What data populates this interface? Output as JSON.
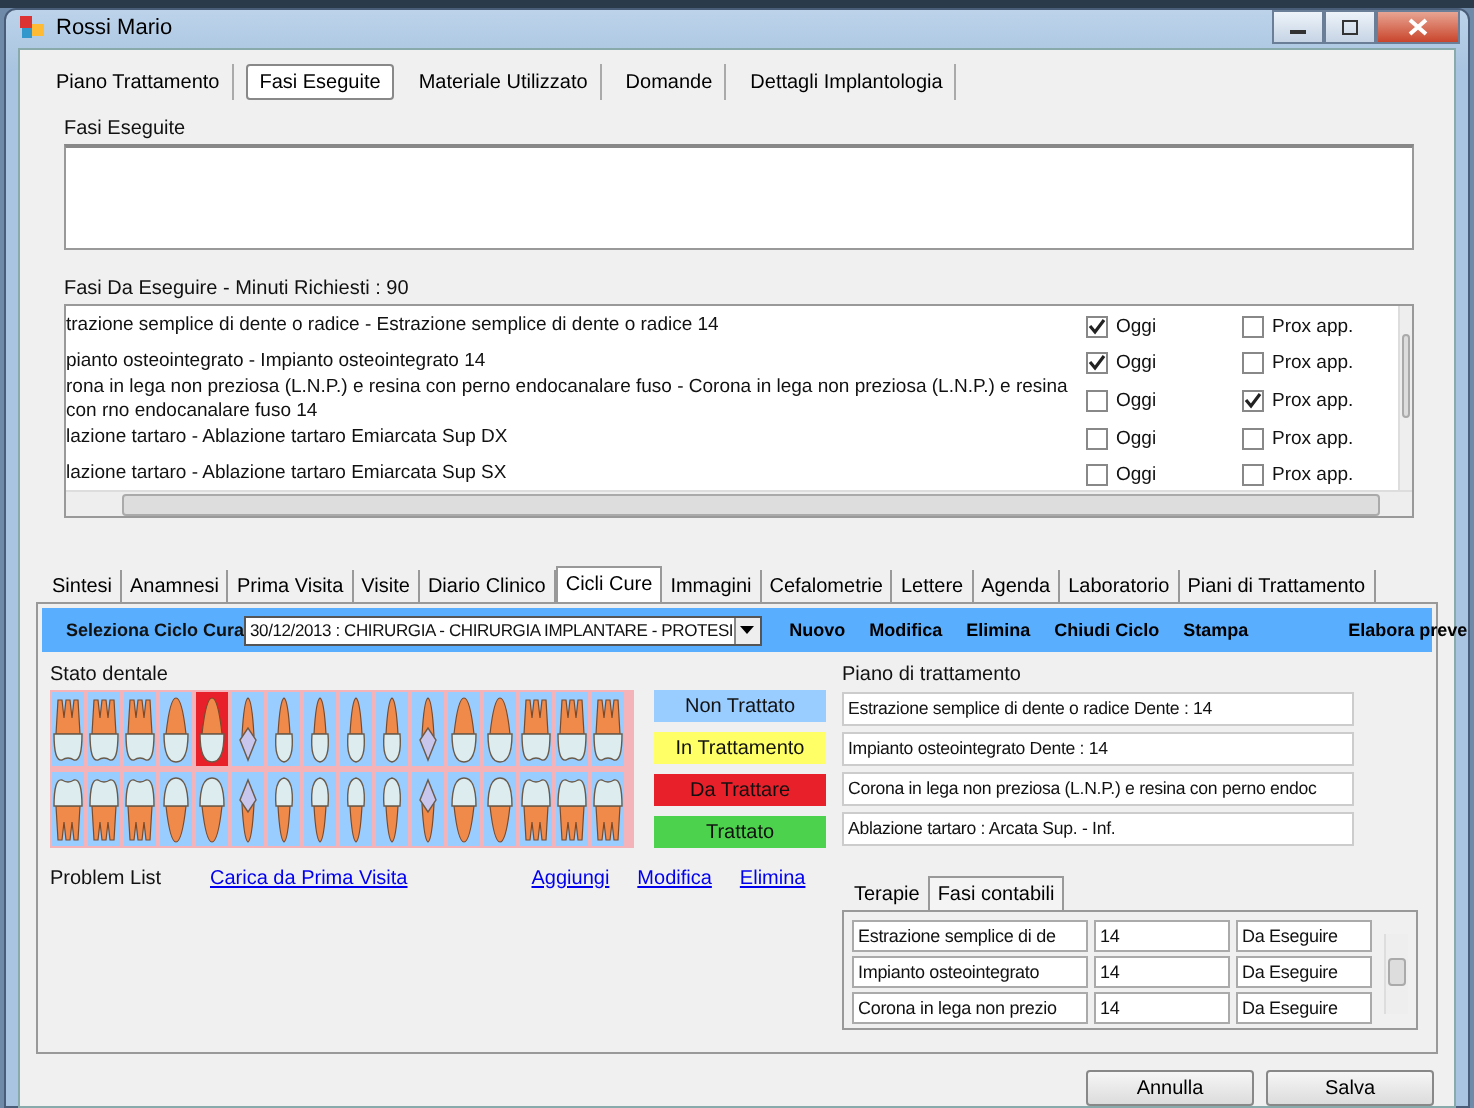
{
  "window": {
    "title": "Rossi Mario"
  },
  "tabs": [
    {
      "label": "Piano Trattamento",
      "selected": false
    },
    {
      "label": "Fasi Eseguite",
      "selected": true
    },
    {
      "label": "Materiale Utilizzato",
      "selected": false
    },
    {
      "label": "Domande",
      "selected": false
    },
    {
      "label": "Dettagli Implantologia",
      "selected": false
    }
  ],
  "fasi_eseguite": {
    "label": "Fasi Eseguite"
  },
  "fasi_da_eseguire": {
    "label": "Fasi Da Eseguire - Minuti Richiesti : 90",
    "rows": [
      {
        "text": "trazione semplice di dente o radice - Estrazione semplice di dente o radice 14",
        "oggi": {
          "label": "Oggi",
          "checked": true
        },
        "prox": {
          "label": "Prox app.",
          "checked": false
        }
      },
      {
        "text": "pianto osteointegrato - Impianto osteointegrato 14",
        "oggi": {
          "label": "Oggi",
          "checked": true
        },
        "prox": {
          "label": "Prox app.",
          "checked": false
        }
      },
      {
        "text": "rona in lega non preziosa (L.N.P.) e resina con perno endocanalare fuso - Corona in lega non preziosa (L.N.P.) e resina con rno endocanalare fuso 14",
        "oggi": {
          "label": "Oggi",
          "checked": false
        },
        "prox": {
          "label": "Prox app.",
          "checked": true
        }
      },
      {
        "text": "lazione tartaro - Ablazione tartaro Emiarcata Sup DX",
        "oggi": {
          "label": "Oggi",
          "checked": false
        },
        "prox": {
          "label": "Prox app.",
          "checked": false
        }
      },
      {
        "text": "lazione tartaro - Ablazione tartaro Emiarcata Sup SX",
        "oggi": {
          "label": "Oggi",
          "checked": false
        },
        "prox": {
          "label": "Prox app.",
          "checked": false
        }
      }
    ]
  },
  "section_tabs": [
    {
      "label": "Sintesi",
      "selected": false
    },
    {
      "label": "Anamnesi",
      "selected": false
    },
    {
      "label": "Prima Visita",
      "selected": false
    },
    {
      "label": "Visite",
      "selected": false
    },
    {
      "label": "Diario Clinico",
      "selected": false
    },
    {
      "label": "Cicli Cure",
      "selected": true
    },
    {
      "label": "Immagini",
      "selected": false
    },
    {
      "label": "Cefalometrie",
      "selected": false
    },
    {
      "label": "Lettere",
      "selected": false
    },
    {
      "label": "Agenda",
      "selected": false
    },
    {
      "label": "Laboratorio",
      "selected": false
    },
    {
      "label": "Piani di Trattamento",
      "selected": false
    }
  ],
  "toolbar": {
    "label": "Seleziona Ciclo Cura",
    "combo": "30/12/2013 : CHIRURGIA - CHIRURGIA IMPLANTARE - PROTESI",
    "actions": [
      "Nuovo",
      "Modifica",
      "Elimina",
      "Chiudi Ciclo",
      "Stampa",
      "Elabora preve"
    ]
  },
  "stato_dentale": {
    "label": "Stato dentale",
    "upper": [
      {
        "kind": "molar",
        "color": "#99ccff"
      },
      {
        "kind": "molar",
        "color": "#99ccff"
      },
      {
        "kind": "molar",
        "color": "#99ccff"
      },
      {
        "kind": "wide",
        "color": "#99ccff"
      },
      {
        "kind": "wide",
        "color": "#e8202a"
      },
      {
        "kind": "crowned",
        "color": "#99ccff"
      },
      {
        "kind": "single",
        "color": "#99ccff"
      },
      {
        "kind": "single",
        "color": "#99ccff"
      },
      {
        "kind": "single",
        "color": "#99ccff"
      },
      {
        "kind": "single",
        "color": "#99ccff"
      },
      {
        "kind": "crowned",
        "color": "#99ccff"
      },
      {
        "kind": "wide",
        "color": "#99ccff"
      },
      {
        "kind": "wide",
        "color": "#99ccff"
      },
      {
        "kind": "molar",
        "color": "#99ccff"
      },
      {
        "kind": "molar",
        "color": "#99ccff"
      },
      {
        "kind": "molar",
        "color": "#99ccff"
      }
    ],
    "lower": [
      {
        "kind": "molar",
        "color": "#99ccff"
      },
      {
        "kind": "molar",
        "color": "#99ccff"
      },
      {
        "kind": "molar",
        "color": "#99ccff"
      },
      {
        "kind": "wide",
        "color": "#99ccff"
      },
      {
        "kind": "wide",
        "color": "#99ccff"
      },
      {
        "kind": "crowned",
        "color": "#99ccff"
      },
      {
        "kind": "single",
        "color": "#99ccff"
      },
      {
        "kind": "single",
        "color": "#99ccff"
      },
      {
        "kind": "single",
        "color": "#99ccff"
      },
      {
        "kind": "single",
        "color": "#99ccff"
      },
      {
        "kind": "crowned",
        "color": "#99ccff"
      },
      {
        "kind": "wide",
        "color": "#99ccff"
      },
      {
        "kind": "wide",
        "color": "#99ccff"
      },
      {
        "kind": "molar",
        "color": "#99ccff"
      },
      {
        "kind": "molar",
        "color": "#99ccff"
      },
      {
        "kind": "molar",
        "color": "#99ccff"
      }
    ],
    "legend": [
      {
        "label": "Non Trattato",
        "color": "#99ccff"
      },
      {
        "label": "In Trattamento",
        "color": "#ffff66"
      },
      {
        "label": "Da Trattare",
        "color": "#e8202a"
      },
      {
        "label": "Trattato",
        "color": "#4cd24c"
      }
    ]
  },
  "problem_list": {
    "label": "Problem List",
    "links": [
      "Carica da Prima Visita",
      "Aggiungi",
      "Modifica",
      "Elimina"
    ]
  },
  "piano": {
    "label": "Piano di trattamento",
    "items": [
      "Estrazione semplice di dente o radice  Dente : 14",
      "Impianto osteointegrato  Dente : 14",
      "Corona in lega non preziosa (L.N.P.) e resina con perno endoc",
      "Ablazione tartaro : Arcata Sup. - Inf."
    ]
  },
  "sub_tabs": [
    {
      "label": "Terapie",
      "selected": false
    },
    {
      "label": "Fasi contabili",
      "selected": true
    }
  ],
  "fasi_contabili": {
    "rows": [
      [
        "Estrazione semplice di de",
        "14",
        "Da Eseguire"
      ],
      [
        "Impianto osteointegrato",
        "14",
        "Da Eseguire"
      ],
      [
        "Corona in lega non prezio",
        "14",
        "Da Eseguire"
      ]
    ]
  },
  "buttons": [
    "Annulla",
    "Salva"
  ]
}
